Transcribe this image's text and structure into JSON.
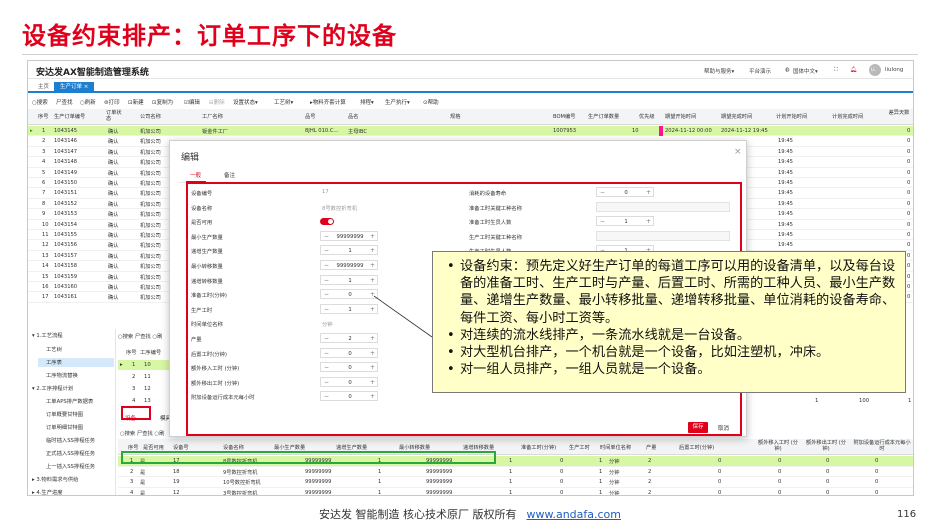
{
  "slide": {
    "title": "设备约束排产：订单工序下的设备",
    "footer_text": "安达发 智能制造 核心技术原厂 版权所有",
    "footer_link": "www.andafa.com",
    "page_number": "116"
  },
  "app": {
    "title": "安达发AX智能制造管理系统",
    "header_links": [
      "帮助与服务▾",
      "平台演示",
      "国体中文▾"
    ],
    "user": "liulong",
    "avatar_text": "LL",
    "tabs": {
      "home": "主页",
      "active": "生产订单 ×"
    },
    "toolbar": [
      "○搜索",
      "尸查找",
      "○刷新",
      "⊜打印",
      "⊡新建",
      "⊡复制为",
      "☑编辑",
      "⊟删除",
      "设置状态▾",
      "工艺树▾",
      "▸物料齐套计算",
      "排程▾",
      "生产执行▾",
      "⊙帮助"
    ]
  },
  "order_grid": {
    "headers": [
      "序号",
      "生产订单编号",
      "订单状态",
      "公司名称",
      "工厂名称",
      "品号",
      "品名",
      "规格",
      "BOM编号",
      "生产订单数量",
      "优先级",
      "期望开始时间",
      "期望完成时间",
      "计划开始时间",
      "计划完成时间",
      "差异天数"
    ],
    "rows": [
      {
        "no": "1",
        "id": "1043145",
        "status": "确认",
        "company": "机加公司",
        "factory": "钣金件工厂",
        "pn": "8JHL 010.C...",
        "name": "主母IBC",
        "bom": "1007953",
        "qty": "10",
        "start": "2024-11-12 00:00",
        "end": "2024-11-12 19:45",
        "diff": "0"
      },
      {
        "no": "2",
        "id": "1043146",
        "status": "确认",
        "company": "机加公司",
        "end_tail": "19:45",
        "diff": "0"
      },
      {
        "no": "3",
        "id": "1043147",
        "status": "确认",
        "company": "机加公司",
        "end_tail": "19:45",
        "diff": "0"
      },
      {
        "no": "4",
        "id": "1043148",
        "status": "确认",
        "company": "机加公司",
        "end_tail": "19:45",
        "diff": "0"
      },
      {
        "no": "5",
        "id": "1043149",
        "status": "确认",
        "company": "机加公司",
        "end_tail": "19:45",
        "diff": "0"
      },
      {
        "no": "6",
        "id": "1043150",
        "status": "确认",
        "company": "机加公司",
        "end_tail": "19:45",
        "diff": "0"
      },
      {
        "no": "7",
        "id": "1043151",
        "status": "确认",
        "company": "机加公司",
        "end_tail": "19:45",
        "diff": "0"
      },
      {
        "no": "8",
        "id": "1043152",
        "status": "确认",
        "company": "机加公司",
        "end_tail": "19:45",
        "diff": "0"
      },
      {
        "no": "9",
        "id": "1043153",
        "status": "确认",
        "company": "机加公司",
        "end_tail": "19:45",
        "diff": "0"
      },
      {
        "no": "10",
        "id": "1043154",
        "status": "确认",
        "company": "机加公司",
        "end_tail": "19:45",
        "diff": "0"
      },
      {
        "no": "11",
        "id": "1043155",
        "status": "确认",
        "company": "机加公司",
        "end_tail": "19:45",
        "diff": "0"
      },
      {
        "no": "12",
        "id": "1043156",
        "status": "确认",
        "company": "机加公司",
        "end_tail": "19:45",
        "diff": "0"
      },
      {
        "no": "13",
        "id": "1043157",
        "status": "确认",
        "company": "机加公司",
        "end_tail": "19:45",
        "diff": "0"
      },
      {
        "no": "14",
        "id": "1043158",
        "status": "确认",
        "company": "机加公司",
        "end_tail": "19:45",
        "diff": "0"
      },
      {
        "no": "15",
        "id": "1043159",
        "status": "确认",
        "company": "机加公司",
        "end_tail": "19:45",
        "diff": "0"
      },
      {
        "no": "16",
        "id": "1043160",
        "status": "确认",
        "company": "机加公司",
        "end_tail": "19:45",
        "diff": "0"
      },
      {
        "no": "17",
        "id": "1043161",
        "status": "确认",
        "company": "机加公司",
        "end_tail": "19:45",
        "diff": "0"
      }
    ]
  },
  "sidebar": {
    "items": [
      "▾ 1.工艺流程",
      "工艺树",
      "工序表",
      "工序物流替换",
      "▾ 2.工序排程计划",
      "工单APS排产数据表",
      "订单概要甘特图",
      "订单明细甘特图",
      "临时插入SS排程任务",
      "正式插入SS排程任务",
      "上一插入SS排程任务",
      "▸ 3.物料需求与供给",
      "▸ 4.生产进度"
    ]
  },
  "process_panel": {
    "toolbar": "○搜索 尸查找 ○刷",
    "headers": [
      "序号",
      "工序编号"
    ],
    "rows": [
      [
        "1",
        "10"
      ],
      [
        "2",
        "11"
      ],
      [
        "3",
        "12"
      ],
      [
        "4",
        "13"
      ]
    ],
    "tabs": [
      "设备",
      "模具"
    ],
    "right_values": [
      "1",
      "100",
      "1"
    ]
  },
  "equipment_table": {
    "toolbar": "○搜索 尸查找 ○刷",
    "headers": [
      "序号",
      "是否可用",
      "设备号",
      "设备名称",
      "最小生产数量",
      "递增生产数量",
      "最小转移数量",
      "递增转移数量",
      "准备工时(分钟)",
      "生产工时",
      "时间单位名称",
      "产量",
      "后置工时(分钟)",
      "额外移入工时 (分钟)",
      "额外移出工时 (分钟)",
      "附加设备运行成本元每小时"
    ],
    "rows": [
      {
        "no": "1",
        "avail": "是",
        "code": "17",
        "name": "8号数控折弯机",
        "min": "99999999",
        "inc": "1",
        "mintr": "99999999",
        "inctr": "1",
        "prep": "0",
        "prod": "1",
        "unit": "分钟",
        "qty": "2",
        "post": "0",
        "in": "0",
        "out": "0",
        "cost": "0"
      },
      {
        "no": "2",
        "avail": "是",
        "code": "18",
        "name": "9号数控折弯机",
        "min": "99999999",
        "inc": "1",
        "mintr": "99999999",
        "inctr": "1",
        "prep": "0",
        "prod": "1",
        "unit": "分钟",
        "qty": "2",
        "post": "0",
        "in": "0",
        "out": "0",
        "cost": "0"
      },
      {
        "no": "3",
        "avail": "是",
        "code": "19",
        "name": "10号数控折弯机",
        "min": "99999999",
        "inc": "1",
        "mintr": "99999999",
        "inctr": "1",
        "prep": "0",
        "prod": "1",
        "unit": "分钟",
        "qty": "2",
        "post": "0",
        "in": "0",
        "out": "0",
        "cost": "0"
      },
      {
        "no": "4",
        "avail": "是",
        "code": "12",
        "name": "3号数控折弯机",
        "min": "99999999",
        "inc": "1",
        "mintr": "99999999",
        "inctr": "1",
        "prep": "0",
        "prod": "1",
        "unit": "分钟",
        "qty": "2",
        "post": "0",
        "in": "0",
        "out": "0",
        "cost": "0"
      }
    ]
  },
  "modal": {
    "title": "编辑",
    "tabs": [
      "一般",
      "备注"
    ],
    "left_fields": [
      {
        "label": "设备编号",
        "value": "17",
        "kind": "text"
      },
      {
        "label": "设备名称",
        "value": "8号数控折弯机",
        "kind": "text"
      },
      {
        "label": "是否可用",
        "value": "",
        "kind": "toggle"
      },
      {
        "label": "最小生产数量",
        "value": "99999999",
        "kind": "stepper"
      },
      {
        "label": "递增生产数量",
        "value": "1",
        "kind": "stepper"
      },
      {
        "label": "最小转移数量",
        "value": "99999999",
        "kind": "stepper"
      },
      {
        "label": "递增转移数量",
        "value": "1",
        "kind": "stepper"
      },
      {
        "label": "准备工时(分钟)",
        "value": "0",
        "kind": "stepper"
      },
      {
        "label": "生产工时",
        "value": "1",
        "kind": "stepper"
      },
      {
        "label": "时间单位名称",
        "value": "分钟",
        "kind": "text"
      },
      {
        "label": "产量",
        "value": "2",
        "kind": "stepper"
      },
      {
        "label": "后置工时(分钟)",
        "value": "0",
        "kind": "stepper"
      },
      {
        "label": "额外移入工时 (分钟)",
        "value": "0",
        "kind": "stepper"
      },
      {
        "label": "额外移出工时 (分钟)",
        "value": "0",
        "kind": "stepper"
      },
      {
        "label": "附加设备运行成本元每小时",
        "value": "0",
        "kind": "stepper"
      }
    ],
    "right_fields": [
      {
        "label": "消耗的设备寿命",
        "value": "0",
        "kind": "stepper"
      },
      {
        "label": "准备工时关键工种名称",
        "value": "",
        "kind": "input"
      },
      {
        "label": "准备工时生员人数",
        "value": "1",
        "kind": "stepper"
      },
      {
        "label": "生产工时关键工种名称",
        "value": "",
        "kind": "input"
      },
      {
        "label": "生产工时生员人数",
        "value": "1",
        "kind": "stepper"
      }
    ],
    "save": "保存",
    "cancel": "取消"
  },
  "callout": {
    "bullets": [
      "设备约束：预先定义好生产订单的每道工序可以用的设备清单，以及每台设备的准备工时、生产工时与产量、后置工时、所需的工种人员、最小生产数量、递增生产数量、最小转移批量、递增转移批量、单位消耗的设备寿命、每件工资、每小时工资等。",
      "对连续的流水线排产，一条流水线就是一台设备。",
      "对大型机台排产，一个机台就是一个设备，比如注塑机，冲床。",
      "对一组人员排产，一组人员就是一个设备。"
    ]
  },
  "colors": {
    "accent_red": "#e0001b",
    "app_blue": "#1e7fd0",
    "selected_row": "#d7f7a4",
    "callout_bg": "#ffffc7",
    "priority_pink": "#ff1493"
  }
}
